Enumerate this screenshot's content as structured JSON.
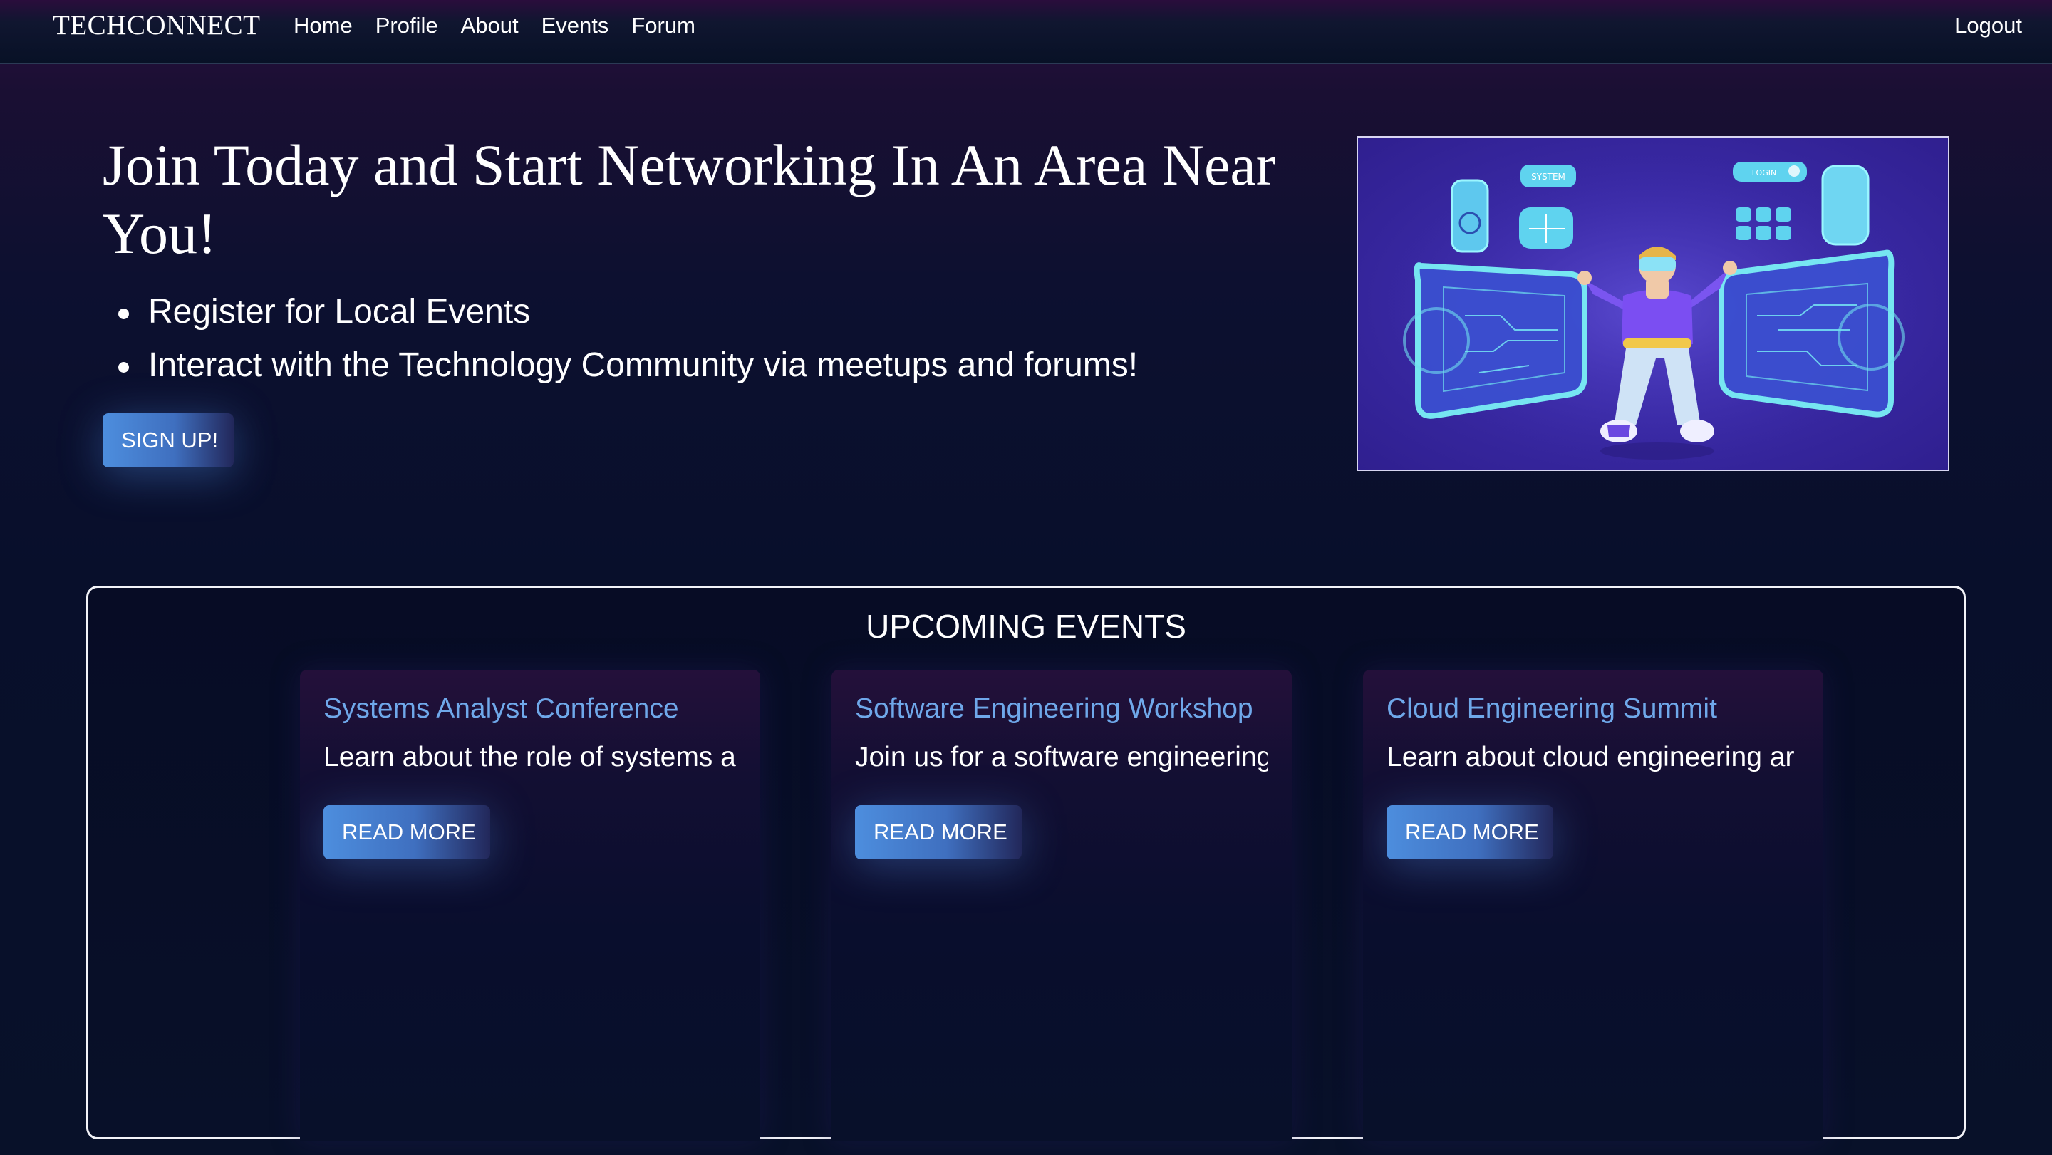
{
  "colors": {
    "accent_blue": "#4d8ede",
    "card_title_blue": "#6fa8ea",
    "background_dark": "#080f2b",
    "hero_image_bg": "#3a2aa6"
  },
  "navbar": {
    "brand": "TECHCONNECT",
    "links": [
      {
        "label": "Home"
      },
      {
        "label": "Profile"
      },
      {
        "label": "About"
      },
      {
        "label": "Events"
      },
      {
        "label": "Forum"
      }
    ],
    "logout_label": "Logout"
  },
  "hero": {
    "title": "Join Today and Start Networking In An Area Near You!",
    "bullets": [
      "Register for Local Events",
      "Interact with the Technology Community via meetups and forums!"
    ],
    "signup_label": "SIGN UP!",
    "image": {
      "icon": "vr-user-illustration",
      "panel_labels": [
        "SYSTEM",
        "LOGIN"
      ]
    }
  },
  "events": {
    "heading": "UPCOMING EVENTS",
    "cards": [
      {
        "title": "Systems Analyst Conference",
        "description": "Learn about the role of systems a",
        "button_label": "READ MORE"
      },
      {
        "title": "Software Engineering Workshop",
        "description": "Join us for a software engineering",
        "button_label": "READ MORE"
      },
      {
        "title": "Cloud Engineering Summit",
        "description": "Learn about cloud engineering ar",
        "button_label": "READ MORE"
      }
    ]
  }
}
